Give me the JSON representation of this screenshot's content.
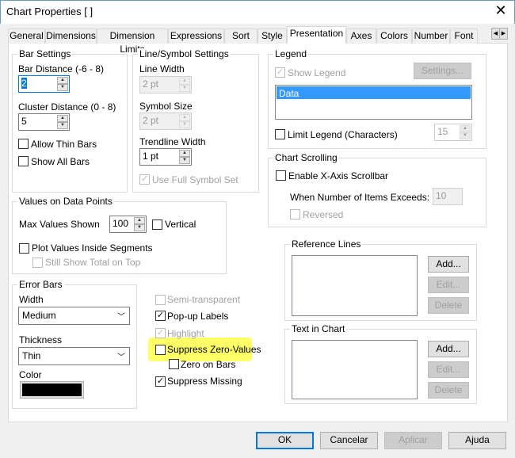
{
  "window": {
    "title": "Chart Properties [ ]"
  },
  "tabs": [
    "General",
    "Dimensions",
    "Dimension Limits",
    "Expressions",
    "Sort",
    "Style",
    "Presentation",
    "Axes",
    "Colors",
    "Number",
    "Font"
  ],
  "active_tab": "Presentation",
  "bar_settings": {
    "title": "Bar Settings",
    "bar_distance_label": "Bar Distance (-6 - 8)",
    "bar_distance": "2",
    "cluster_distance_label": "Cluster Distance (0 - 8)",
    "cluster_distance": "5",
    "allow_thin_bars": "Allow Thin Bars",
    "show_all_bars": "Show All Bars"
  },
  "line_symbol": {
    "title": "Line/Symbol Settings",
    "line_width_label": "Line Width",
    "line_width": "2 pt",
    "symbol_size_label": "Symbol Size",
    "symbol_size": "2 pt",
    "trendline_width_label": "Trendline Width",
    "trendline_width": "1 pt",
    "use_full_symbol_set": "Use Full Symbol Set"
  },
  "values_on_points": {
    "title": "Values on Data Points",
    "max_values_label": "Max Values Shown",
    "max_values": "100",
    "vertical": "Vertical",
    "plot_inside": "Plot Values Inside Segments",
    "still_show_total": "Still Show Total on Top"
  },
  "error_bars": {
    "title": "Error Bars",
    "width_label": "Width",
    "width": "Medium",
    "thickness_label": "Thickness",
    "thickness": "Thin",
    "color_label": "Color",
    "color": "#000000"
  },
  "options": {
    "semi_transparent": "Semi-transparent",
    "popup_labels": "Pop-up Labels",
    "highlight": "Highlight",
    "suppress_zero": "Suppress Zero-Values",
    "zero_on_bars": "Zero on Bars",
    "suppress_missing": "Suppress Missing",
    "highlight_color": "#ffff66"
  },
  "legend": {
    "title": "Legend",
    "show_legend": "Show Legend",
    "settings": "Settings...",
    "items": [
      "Data"
    ],
    "limit_legend": "Limit Legend (Characters)",
    "limit_value": "15"
  },
  "chart_scrolling": {
    "title": "Chart Scrolling",
    "enable_scrollbar": "Enable X-Axis Scrollbar",
    "exceeds_label": "When Number of Items Exceeds:",
    "exceeds_value": "10",
    "reversed": "Reversed"
  },
  "reference_lines": {
    "title": "Reference Lines",
    "add": "Add...",
    "edit": "Edit...",
    "delete": "Delete"
  },
  "text_in_chart": {
    "title": "Text in Chart",
    "add": "Add...",
    "edit": "Edit...",
    "delete": "Delete"
  },
  "footer": {
    "ok": "OK",
    "cancel": "Cancelar",
    "apply": "Aplicar",
    "help": "Ajuda"
  }
}
